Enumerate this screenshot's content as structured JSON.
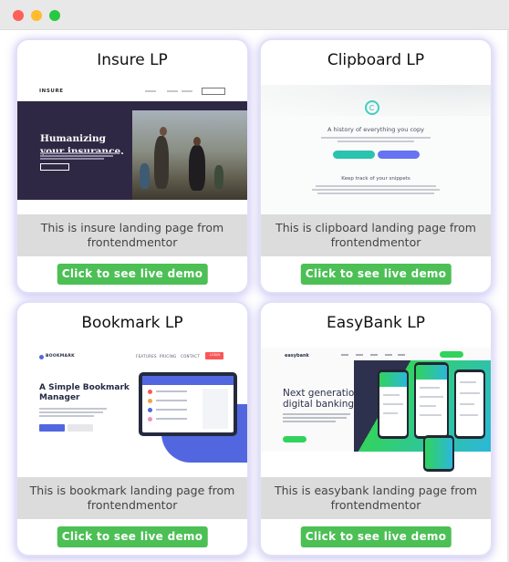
{
  "window": {
    "controls": [
      "close",
      "minimize",
      "maximize"
    ]
  },
  "cards": [
    {
      "title": "Insure LP",
      "description": "This is insure landing page from frontendmentor",
      "button": "Click to see live demo",
      "thumbnail": {
        "logo": "INSURE",
        "headline": [
          "Humanizing",
          "your insurance."
        ]
      }
    },
    {
      "title": "Clipboard LP",
      "description": "This is clipboard landing page from frontendmentor",
      "button": "Click to see live demo",
      "thumbnail": {
        "headline": "A history of everything you copy",
        "subheadline": "Keep track of your snippets"
      }
    },
    {
      "title": "Bookmark LP",
      "description": "This is bookmark landing page from frontendmentor",
      "button": "Click to see live demo",
      "thumbnail": {
        "logo": "BOOKMARK",
        "nav": [
          "FEATURES",
          "PRICING",
          "CONTACT"
        ],
        "login": "LOGIN",
        "headline": [
          "A Simple Bookmark",
          "Manager"
        ]
      }
    },
    {
      "title": "EasyBank LP",
      "description": "This is easybank landing page from frontendmentor",
      "button": "Click to see live demo",
      "thumbnail": {
        "logo": "easybank",
        "headline": [
          "Next generation",
          "digital banking"
        ]
      }
    }
  ],
  "colors": {
    "button": "#4cbf55",
    "card_glow": "#8c82e6",
    "description_bg": "#dcdcdc"
  }
}
